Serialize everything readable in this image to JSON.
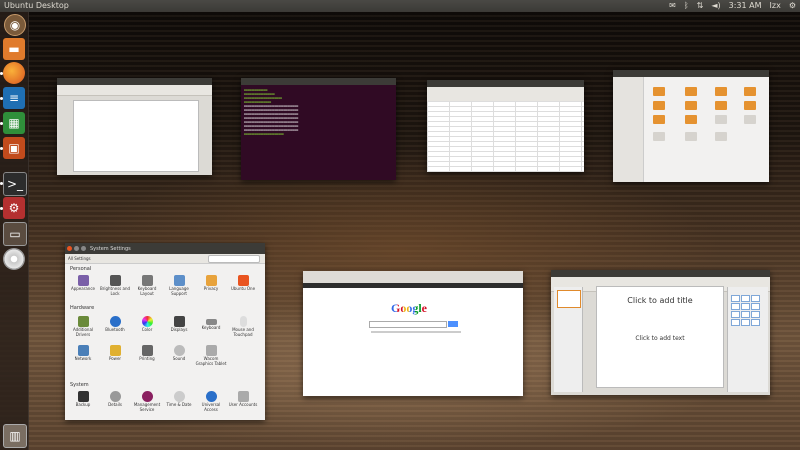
{
  "panel": {
    "title": "Ubuntu Desktop",
    "clock": "3:31 AM",
    "user": "Izx"
  },
  "launcher": {
    "items": [
      "dash-home",
      "files",
      "firefox",
      "libreoffice-writer",
      "libreoffice-calc",
      "libreoffice-impress",
      "terminal",
      "system-settings",
      "workspace-switcher",
      "dvd",
      "trash"
    ]
  },
  "windows": {
    "settings": {
      "title": "System Settings",
      "toolbar": "All Settings",
      "sections": {
        "personal": "Personal",
        "hardware": "Hardware",
        "system": "System"
      },
      "personal_items": [
        "Appearance",
        "Brightness and Lock",
        "Keyboard Layout",
        "Language Support",
        "Privacy",
        "Ubuntu One"
      ],
      "hardware_items": [
        "Additional Drivers",
        "Bluetooth",
        "Color",
        "Displays",
        "Keyboard",
        "Mouse and Touchpad"
      ],
      "hardware_items2": [
        "Network",
        "Power",
        "Printing",
        "Sound",
        "Wacom Graphics Tablet"
      ],
      "system_items": [
        "Backup",
        "Details",
        "Management Service",
        "Time & Date",
        "Universal Access",
        "User Accounts"
      ]
    },
    "browser": {
      "logo": "Google"
    },
    "impress": {
      "title_placeholder": "Click to add title",
      "text_placeholder": "Click to add text"
    }
  },
  "colors": {
    "panel": "#3c3b37",
    "terminal_bg": "#300a24",
    "ubuntu_orange": "#e95420"
  }
}
